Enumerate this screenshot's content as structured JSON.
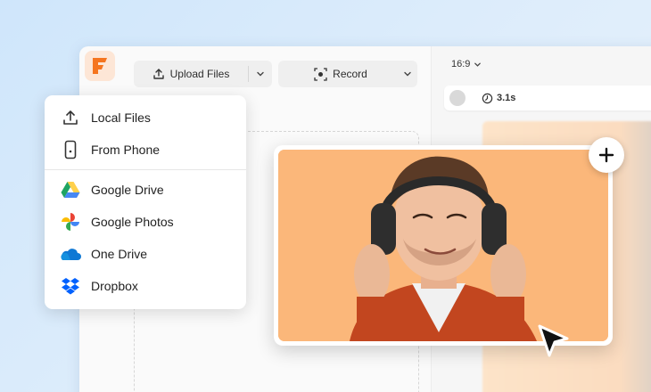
{
  "toolbar": {
    "upload_label": "Upload Files",
    "record_label": "Record"
  },
  "preview": {
    "aspect_ratio": "16:9",
    "duration": "3.1s"
  },
  "upload_menu": {
    "items": [
      {
        "label": "Local Files",
        "icon": "upload-icon"
      },
      {
        "label": "From Phone",
        "icon": "phone-icon"
      },
      {
        "label": "Google Drive",
        "icon": "google-drive-icon"
      },
      {
        "label": "Google Photos",
        "icon": "google-photos-icon"
      },
      {
        "label": "One Drive",
        "icon": "onedrive-icon"
      },
      {
        "label": "Dropbox",
        "icon": "dropbox-icon"
      }
    ]
  },
  "colors": {
    "brand": "#f5751f",
    "photo_background": "#fbb77a",
    "drive_green": "#1fa463",
    "drive_yellow": "#ffd04b",
    "drive_blue": "#4688f4",
    "onedrive_blue": "#0f78d4",
    "dropbox_blue": "#0061fe"
  }
}
